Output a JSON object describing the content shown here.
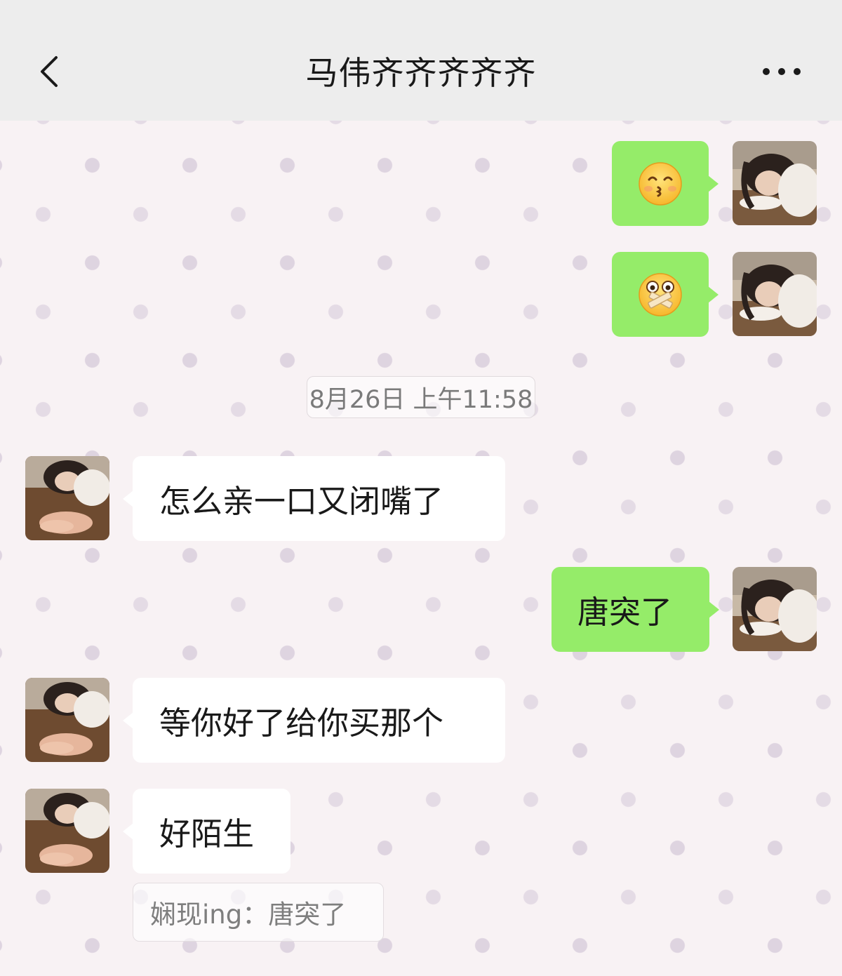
{
  "header": {
    "title": "马伟齐齐齐齐齐"
  },
  "timestamp": "8月26日 上午11:58",
  "messages": [
    {
      "sender": "me",
      "emoji": "kissing-face-emoji"
    },
    {
      "sender": "me",
      "emoji": "zipped-mouth-surprised-emoji"
    },
    {
      "sender": "other",
      "text": "怎么亲一口又闭嘴了"
    },
    {
      "sender": "me",
      "text": "唐突了"
    },
    {
      "sender": "other",
      "text": "等你好了给你买那个"
    },
    {
      "sender": "other",
      "text": "好陌生"
    }
  ],
  "quote": {
    "text": "娴现ing：唐突了"
  },
  "colors": {
    "header_bg": "#ededed",
    "my_bubble": "#95ec69",
    "other_bubble": "#ffffff",
    "text": "#191919"
  },
  "icons": {
    "back": "chevron-left-icon",
    "more": "more-dots-icon"
  }
}
